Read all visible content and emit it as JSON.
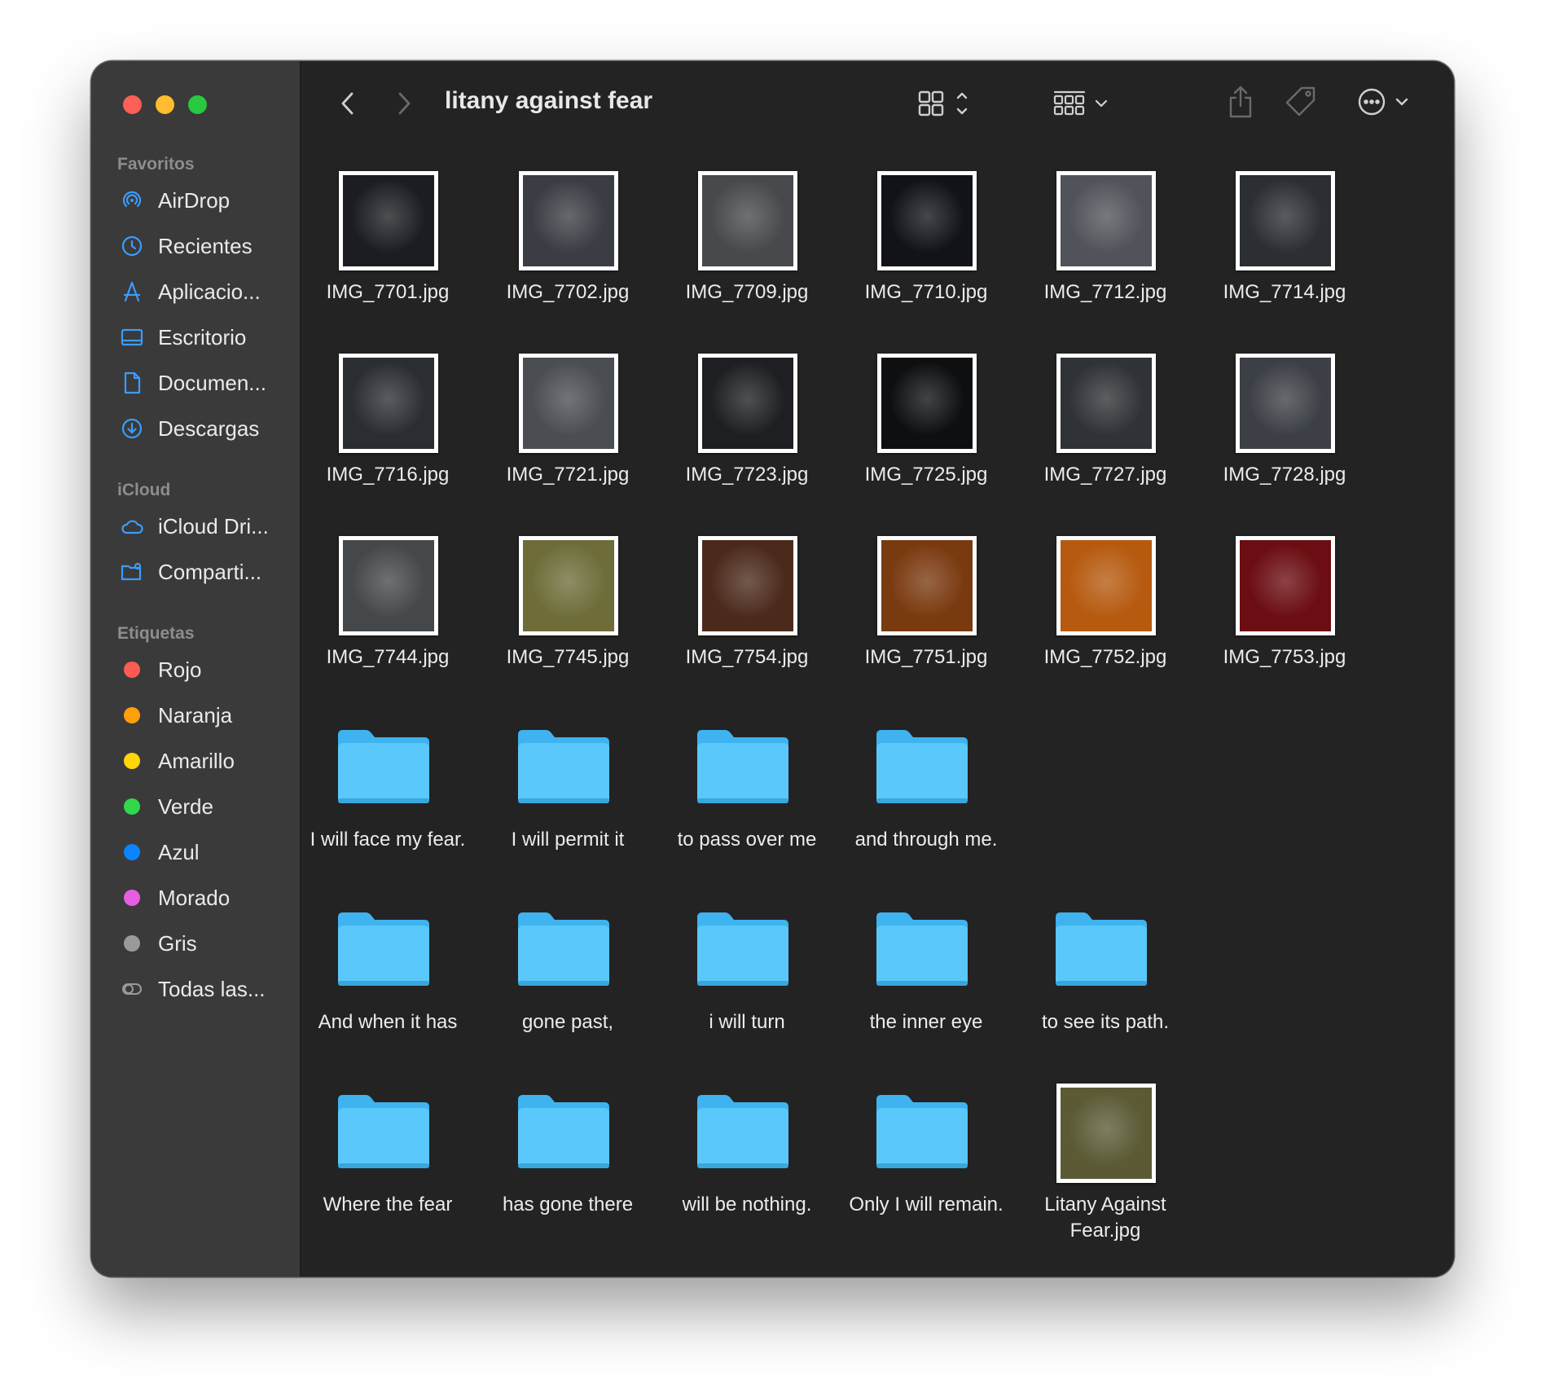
{
  "window": {
    "title": "litany against fear"
  },
  "sidebar": {
    "sections": [
      {
        "label": "Favoritos"
      },
      {
        "label": "iCloud"
      },
      {
        "label": "Etiquetas"
      }
    ],
    "favorites": [
      {
        "label": "AirDrop",
        "icon": "airdrop-icon"
      },
      {
        "label": "Recientes",
        "icon": "clock-icon"
      },
      {
        "label": "Aplicacio...",
        "icon": "applications-icon"
      },
      {
        "label": "Escritorio",
        "icon": "desktop-icon"
      },
      {
        "label": "Documen...",
        "icon": "document-icon"
      },
      {
        "label": "Descargas",
        "icon": "download-icon"
      }
    ],
    "icloud": [
      {
        "label": "iCloud Dri...",
        "icon": "cloud-icon"
      },
      {
        "label": "Comparti...",
        "icon": "shared-folder-icon"
      }
    ],
    "tags": [
      {
        "label": "Rojo",
        "color": "#ff5b55"
      },
      {
        "label": "Naranja",
        "color": "#ff9f0a"
      },
      {
        "label": "Amarillo",
        "color": "#ffd60a"
      },
      {
        "label": "Verde",
        "color": "#32d74b"
      },
      {
        "label": "Azul",
        "color": "#0a84ff"
      },
      {
        "label": "Morado",
        "color": "#e85ee3"
      },
      {
        "label": "Gris",
        "color": "#9a9a9a"
      },
      {
        "label": "Todas las...",
        "color": "outline"
      }
    ]
  },
  "items": [
    {
      "name": "IMG_7701.jpg",
      "type": "image",
      "tone": "#1b1d22"
    },
    {
      "name": "IMG_7702.jpg",
      "type": "image",
      "tone": "#3a3e44"
    },
    {
      "name": "IMG_7709.jpg",
      "type": "image",
      "tone": "#47494c"
    },
    {
      "name": "IMG_7710.jpg",
      "type": "image",
      "tone": "#111318"
    },
    {
      "name": "IMG_7712.jpg",
      "type": "image",
      "tone": "#50545a"
    },
    {
      "name": "IMG_7714.jpg",
      "type": "image",
      "tone": "#2b2e33"
    },
    {
      "name": "IMG_7716.jpg",
      "type": "image",
      "tone": "#2a2e33"
    },
    {
      "name": "IMG_7721.jpg",
      "type": "image",
      "tone": "#4a4d52"
    },
    {
      "name": "IMG_7723.jpg",
      "type": "image",
      "tone": "#1d1f22"
    },
    {
      "name": "IMG_7725.jpg",
      "type": "image",
      "tone": "#0e0f11"
    },
    {
      "name": "IMG_7727.jpg",
      "type": "image",
      "tone": "#2f3236"
    },
    {
      "name": "IMG_7728.jpg",
      "type": "image",
      "tone": "#3c4046"
    },
    {
      "name": "IMG_7744.jpg",
      "type": "image",
      "tone": "#45484a"
    },
    {
      "name": "IMG_7745.jpg",
      "type": "image",
      "tone": "#6e6d3a"
    },
    {
      "name": "IMG_7754.jpg",
      "type": "image",
      "tone": "#4b2a1c"
    },
    {
      "name": "IMG_7751.jpg",
      "type": "image",
      "tone": "#7a3a10"
    },
    {
      "name": "IMG_7752.jpg",
      "type": "image",
      "tone": "#b65a10"
    },
    {
      "name": "IMG_7753.jpg",
      "type": "image",
      "tone": "#6b0d12"
    },
    {
      "name": "I will face my fear.",
      "type": "folder"
    },
    {
      "name": "I will permit it",
      "type": "folder"
    },
    {
      "name": "to pass over me",
      "type": "folder"
    },
    {
      "name": "and through me.",
      "type": "folder"
    },
    {
      "name": "And when it has",
      "type": "folder"
    },
    {
      "name": "gone past,",
      "type": "folder"
    },
    {
      "name": "i will turn",
      "type": "folder"
    },
    {
      "name": "the inner eye",
      "type": "folder"
    },
    {
      "name": "to see its path.",
      "type": "folder"
    },
    {
      "name": "Where the fear",
      "type": "folder"
    },
    {
      "name": "has gone there",
      "type": "folder"
    },
    {
      "name": "will be nothing.",
      "type": "folder"
    },
    {
      "name": "Only I will remain.",
      "type": "folder"
    },
    {
      "name": "Litany Against Fear.jpg",
      "type": "image",
      "tone": "#5b5a35"
    }
  ],
  "toolbar": {
    "back_icon": "chevron-left-icon",
    "forward_icon": "chevron-right-icon",
    "view_icon": "grid-view-icon",
    "group_icon": "group-icon",
    "share_icon": "share-icon",
    "tag_icon": "tag-icon",
    "more_icon": "more-icon",
    "search_icon": "search-icon"
  }
}
